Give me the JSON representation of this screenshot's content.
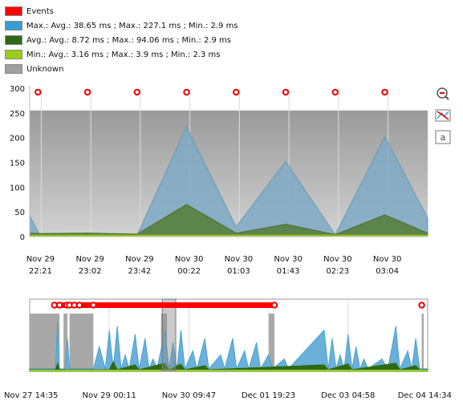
{
  "colors": {
    "events": "#ff0000",
    "max": "#3a9bd1",
    "avg": "#2d6a12",
    "min": "#9acd1a",
    "unknown": "#a0a0a0"
  },
  "legend": [
    {
      "label": "Events",
      "color": "#ff0000"
    },
    {
      "label": "Max.: Avg.: 38.65 ms ; Max.: 227.1 ms ; Min.: 2.9 ms",
      "color": "#3a9bd1"
    },
    {
      "label": "Avg.: Avg.: 8.72 ms ; Max.: 94.06 ms ; Min.: 2.9 ms",
      "color": "#2d6a12"
    },
    {
      "label": "Min.: Avg.: 3.16 ms ; Max.: 3.9 ms ; Min.: 2.3 ms",
      "color": "#9acd1a"
    },
    {
      "label": "Unknown",
      "color": "#a0a0a0"
    }
  ],
  "tools": [
    "zoom-out-icon",
    "chart-type-icon",
    "label-icon"
  ],
  "chart_data": [
    {
      "type": "area",
      "yticks": [
        "300",
        "250",
        "200",
        "150",
        "100",
        "50",
        "0"
      ],
      "ylim": [
        0,
        300
      ],
      "xticks": [
        {
          "line1": "Nov 29",
          "line2": "22:21"
        },
        {
          "line1": "Nov 29",
          "line2": "23:02"
        },
        {
          "line1": "Nov 29",
          "line2": "23:42"
        },
        {
          "line1": "Nov 30",
          "line2": "00:22"
        },
        {
          "line1": "Nov 30",
          "line2": "01:03"
        },
        {
          "line1": "Nov 30",
          "line2": "01:43"
        },
        {
          "line1": "Nov 30",
          "line2": "02:23"
        },
        {
          "line1": "Nov 30",
          "line2": "03:04"
        }
      ],
      "x_range_minutes": [
        -19,
        222
      ],
      "event_minutes": [
        -14,
        16,
        46,
        76,
        106,
        136,
        166,
        196
      ],
      "unknown_level": 255,
      "series": [
        {
          "name": "Max.",
          "x": [
            -19,
            -13,
            16,
            46,
            76,
            106,
            136,
            166,
            196,
            222
          ],
          "y": [
            42,
            4,
            4,
            3,
            222,
            20,
            152,
            4,
            202,
            38
          ]
        },
        {
          "name": "Avg.",
          "x": [
            -19,
            -13,
            16,
            46,
            76,
            106,
            136,
            166,
            196,
            222
          ],
          "y": [
            7,
            6,
            7,
            5,
            65,
            7,
            25,
            4,
            44,
            7
          ]
        },
        {
          "name": "Min.",
          "x": [
            -19,
            -13,
            16,
            46,
            76,
            106,
            136,
            166,
            196,
            222
          ],
          "y": [
            3,
            3,
            3,
            3,
            3,
            3,
            3,
            3,
            3,
            3
          ]
        }
      ]
    },
    {
      "type": "area",
      "role": "overview",
      "xticks": [
        "Nov 27 14:35",
        "Nov 29 00:11",
        "Nov 30 09:47",
        "Dec 01 19:23",
        "Dec 03 04:58",
        "Dec 04 14:34"
      ],
      "selection_range": [
        0.333,
        0.367
      ],
      "event_band": [
        0.06,
        0.615
      ],
      "event_points": [
        0.062,
        0.075,
        0.093,
        0.1,
        0.112,
        0.125,
        0.16,
        0.615,
        0.985
      ],
      "unknown_ranges": [
        [
          0.0,
          0.075
        ],
        [
          0.085,
          0.095
        ],
        [
          0.1,
          0.16
        ],
        [
          0.33,
          0.345
        ],
        [
          0.6,
          0.615
        ],
        [
          0.985,
          0.99
        ]
      ],
      "max_series": [
        [
          0.0,
          3
        ],
        [
          0.065,
          3
        ],
        [
          0.07,
          60
        ],
        [
          0.075,
          3
        ],
        [
          0.09,
          3
        ],
        [
          0.095,
          40
        ],
        [
          0.1,
          3
        ],
        [
          0.16,
          3
        ],
        [
          0.175,
          30
        ],
        [
          0.19,
          3
        ],
        [
          0.2,
          50
        ],
        [
          0.21,
          3
        ],
        [
          0.22,
          55
        ],
        [
          0.23,
          3
        ],
        [
          0.24,
          20
        ],
        [
          0.25,
          3
        ],
        [
          0.265,
          45
        ],
        [
          0.275,
          3
        ],
        [
          0.29,
          40
        ],
        [
          0.3,
          3
        ],
        [
          0.31,
          15
        ],
        [
          0.32,
          3
        ],
        [
          0.34,
          50
        ],
        [
          0.35,
          3
        ],
        [
          0.36,
          35
        ],
        [
          0.37,
          3
        ],
        [
          0.38,
          50
        ],
        [
          0.39,
          3
        ],
        [
          0.41,
          25
        ],
        [
          0.42,
          3
        ],
        [
          0.44,
          40
        ],
        [
          0.45,
          3
        ],
        [
          0.48,
          20
        ],
        [
          0.49,
          3
        ],
        [
          0.51,
          40
        ],
        [
          0.52,
          3
        ],
        [
          0.54,
          25
        ],
        [
          0.55,
          3
        ],
        [
          0.57,
          35
        ],
        [
          0.58,
          3
        ],
        [
          0.6,
          20
        ],
        [
          0.61,
          3
        ],
        [
          0.64,
          15
        ],
        [
          0.65,
          3
        ],
        [
          0.74,
          50
        ],
        [
          0.75,
          3
        ],
        [
          0.76,
          40
        ],
        [
          0.77,
          3
        ],
        [
          0.78,
          20
        ],
        [
          0.79,
          3
        ],
        [
          0.8,
          45
        ],
        [
          0.81,
          3
        ],
        [
          0.82,
          30
        ],
        [
          0.83,
          3
        ],
        [
          0.84,
          15
        ],
        [
          0.85,
          3
        ],
        [
          0.885,
          15
        ],
        [
          0.9,
          3
        ],
        [
          0.92,
          55
        ],
        [
          0.93,
          3
        ],
        [
          0.95,
          25
        ],
        [
          0.96,
          3
        ],
        [
          0.97,
          40
        ],
        [
          0.98,
          3
        ],
        [
          1.0,
          3
        ]
      ],
      "avg_series": [
        [
          0.0,
          2
        ],
        [
          0.065,
          2
        ],
        [
          0.07,
          10
        ],
        [
          0.075,
          2
        ],
        [
          0.2,
          2
        ],
        [
          0.21,
          12
        ],
        [
          0.22,
          2
        ],
        [
          0.265,
          8
        ],
        [
          0.275,
          2
        ],
        [
          0.34,
          10
        ],
        [
          0.35,
          2
        ],
        [
          0.38,
          9
        ],
        [
          0.39,
          2
        ],
        [
          0.44,
          7
        ],
        [
          0.45,
          2
        ],
        [
          0.74,
          8
        ],
        [
          0.75,
          2
        ],
        [
          0.8,
          9
        ],
        [
          0.81,
          2
        ],
        [
          0.92,
          10
        ],
        [
          0.93,
          2
        ],
        [
          0.97,
          7
        ],
        [
          0.98,
          2
        ],
        [
          1.0,
          2
        ]
      ]
    }
  ]
}
